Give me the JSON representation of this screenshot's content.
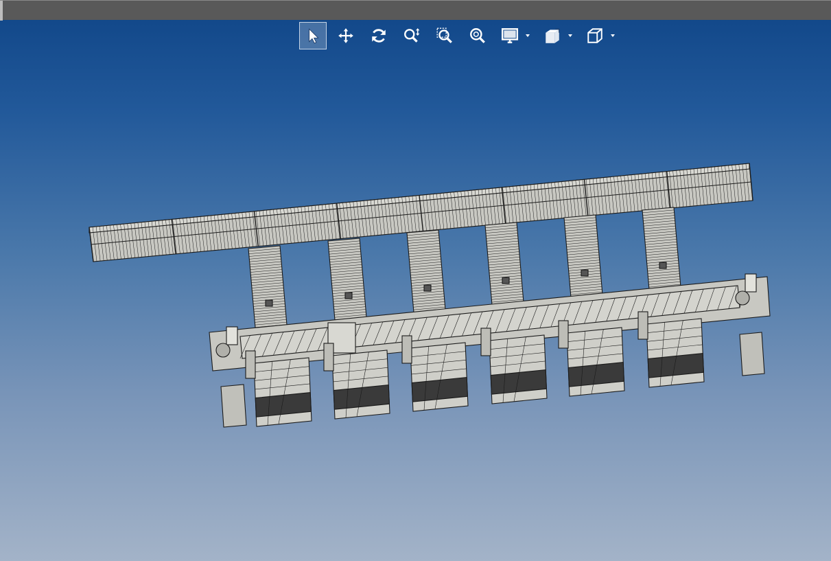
{
  "window": {
    "title": ""
  },
  "toolbar": {
    "tools": [
      {
        "name": "select-tool",
        "icon": "pointer-arrow-icon",
        "active": true
      },
      {
        "name": "pan-tool",
        "icon": "move-arrows-icon",
        "active": false
      },
      {
        "name": "rotate-tool",
        "icon": "rotate-icon",
        "active": false
      },
      {
        "name": "zoom-tool",
        "icon": "zoom-updown-icon",
        "active": false
      },
      {
        "name": "zoom-window-tool",
        "icon": "zoom-window-icon",
        "active": false
      },
      {
        "name": "zoom-fit-tool",
        "icon": "zoom-fit-icon",
        "active": false
      },
      {
        "name": "display-mode-tool",
        "icon": "monitor-icon",
        "active": false,
        "dropdown": true
      },
      {
        "name": "section-tool",
        "icon": "section-view-icon",
        "active": false,
        "dropdown": true
      },
      {
        "name": "view-orientation-tool",
        "icon": "cube-view-icon",
        "active": false,
        "dropdown": true
      }
    ]
  },
  "viewport": {
    "background_top": "#0f4587",
    "background_bottom": "#a3b3c8",
    "model": {
      "description_icon": "conveyor-assembly-model",
      "lanes": 6,
      "line_color": "#1a1a1a",
      "fill_color": "#c8c8c2"
    }
  }
}
